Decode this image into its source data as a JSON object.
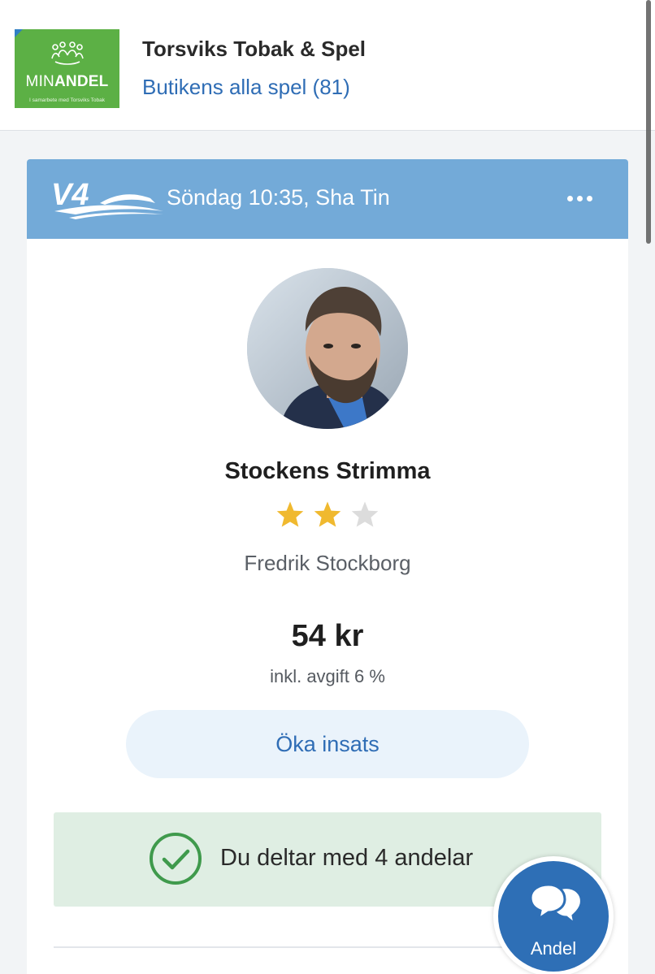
{
  "store": {
    "logo": {
      "word_light": "MIN",
      "word_bold": "ANDEL",
      "tagline": "I samarbete med Torsviks Tobak"
    },
    "name": "Torsviks Tobak & Spel",
    "all_games_link": "Butikens alla spel (81)"
  },
  "card": {
    "game_logo": "V4",
    "race_title": "Söndag 10:35, Sha Tin",
    "more_icon": "ellipsis-icon",
    "group_name": "Stockens Strimma",
    "rating": {
      "value": 2,
      "max": 5,
      "shown": 3
    },
    "owner": "Fredrik Stockborg",
    "price": "54 kr",
    "fee_note": "inkl. avgift 6 %",
    "increase_stake_label": "Öka insats",
    "participation_text": "Du deltar med 4 andelar"
  },
  "chat": {
    "label": "Andel",
    "icon": "chat-bubbles-icon"
  },
  "colors": {
    "header_blue": "#73aad8",
    "link_blue": "#2f6db5",
    "logo_green": "#5cb045",
    "star_gold": "#f0b92f",
    "star_empty": "#dcdcdc",
    "success_green": "#3f9a4c",
    "success_bg": "#dfeee3",
    "fab_blue": "#2e6fb6"
  }
}
